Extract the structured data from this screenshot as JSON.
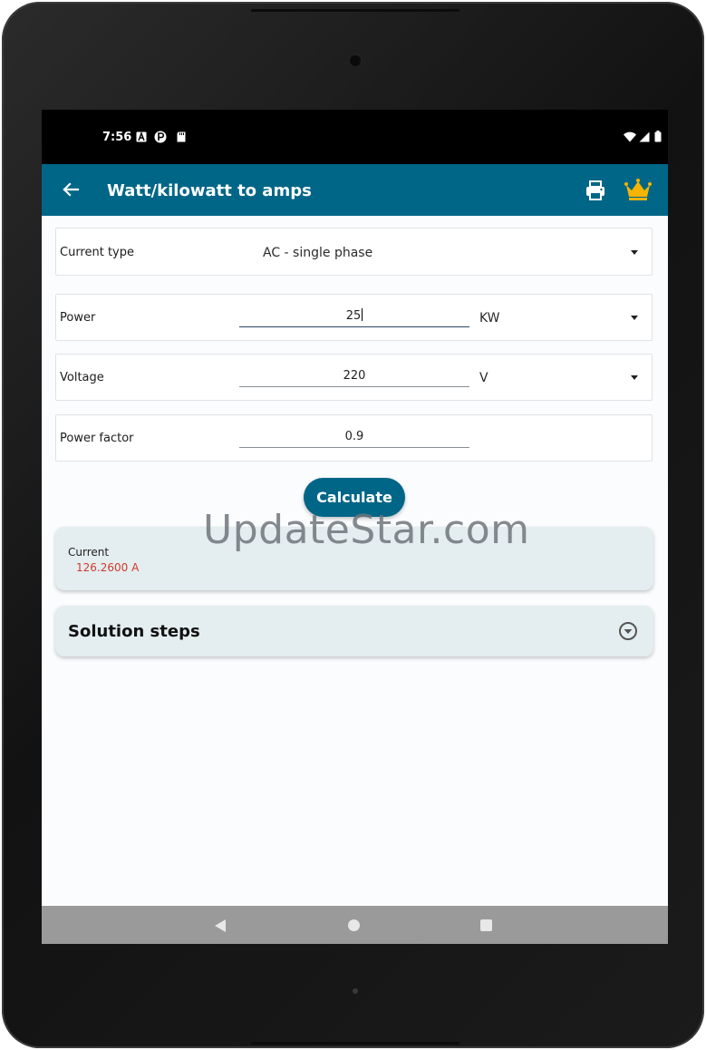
{
  "status_bar": {
    "time": "7:56"
  },
  "app_bar": {
    "title": "Watt/kilowatt to amps"
  },
  "form": {
    "current_type": {
      "label": "Current type",
      "value": "AC - single phase"
    },
    "power": {
      "label": "Power",
      "value": "25",
      "unit": "KW"
    },
    "voltage": {
      "label": "Voltage",
      "value": "220",
      "unit": "V"
    },
    "power_factor": {
      "label": "Power factor",
      "value": "0.9"
    }
  },
  "calculate_label": "Calculate",
  "result": {
    "label": "Current",
    "value": "126.2600 A",
    "value_color": "#d03a2a"
  },
  "solution": {
    "title": "Solution steps"
  },
  "watermark": "UpdateStar.com",
  "colors": {
    "primary": "#006687",
    "accent_crown": "#f4b400"
  }
}
